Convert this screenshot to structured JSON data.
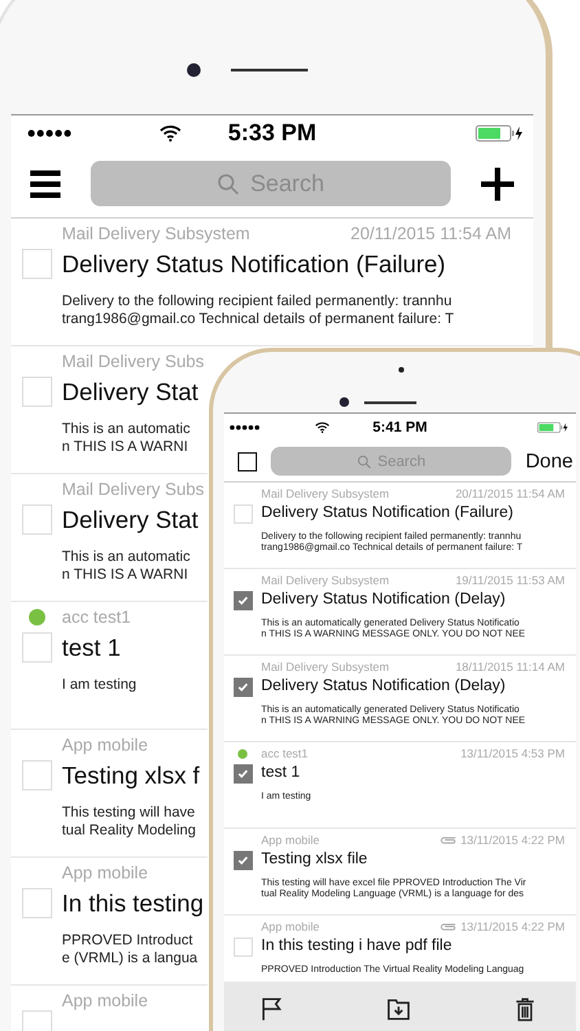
{
  "back_phone": {
    "status_bar": {
      "time": "5:33 PM"
    },
    "search": {
      "placeholder": "Search"
    },
    "messages": [
      {
        "sender": "Mail Delivery Subsystem",
        "date": "20/11/2015 11:54 AM",
        "title": "Delivery Status Notification (Failure)",
        "preview": [
          "Delivery to the following recipient failed permanently: trannhu",
          "trang1986@gmail.co Technical details of permanent failure: T"
        ],
        "checked": false,
        "unread": false
      },
      {
        "sender": "Mail Delivery Subs",
        "title": "Delivery Stat",
        "preview": [
          "This is an automatic",
          "n THIS IS A WARNI"
        ],
        "checked": false,
        "unread": false
      },
      {
        "sender": "Mail Delivery Subs",
        "title": "Delivery Stat",
        "preview": [
          "This is an automatic",
          "n THIS IS A WARNI"
        ],
        "checked": false,
        "unread": false
      },
      {
        "sender": "acc test1",
        "title": "test 1",
        "preview": [
          "I am testing"
        ],
        "checked": false,
        "unread": true
      },
      {
        "sender": "App mobile",
        "title": "Testing xlsx f",
        "preview": [
          "This testing will have",
          "tual Reality Modeling"
        ],
        "checked": false,
        "unread": false
      },
      {
        "sender": "App mobile",
        "title": "In this testing",
        "preview": [
          "PPROVED Introduct",
          "e (VRML) is a langua"
        ],
        "checked": false,
        "unread": false
      },
      {
        "sender": "App mobile",
        "checked": false,
        "unread": false
      }
    ]
  },
  "front_phone": {
    "status_bar": {
      "time": "5:41 PM"
    },
    "select_all": {
      "checked": false
    },
    "search": {
      "placeholder": "Search"
    },
    "done_button": "Done",
    "messages": [
      {
        "sender": "Mail Delivery Subsystem",
        "date": "20/11/2015 11:54 AM",
        "title": "Delivery Status Notification (Failure)",
        "preview": [
          "Delivery to the following recipient failed permanently: trannhu",
          "trang1986@gmail.co Technical details of permanent failure: T"
        ],
        "checked": false,
        "unread": false,
        "attachment": false
      },
      {
        "sender": "Mail Delivery Subsystem",
        "date": "19/11/2015 11:53 AM",
        "title": "Delivery Status Notification (Delay)",
        "preview": [
          "This is an automatically generated Delivery Status Notificatio",
          "n THIS IS A WARNING MESSAGE ONLY. YOU DO NOT NEE"
        ],
        "checked": true,
        "unread": false,
        "attachment": false
      },
      {
        "sender": "Mail Delivery Subsystem",
        "date": "18/11/2015 11:14 AM",
        "title": "Delivery Status Notification (Delay)",
        "preview": [
          "This is an automatically generated Delivery Status Notificatio",
          "n THIS IS A WARNING MESSAGE ONLY. YOU DO NOT NEE"
        ],
        "checked": true,
        "unread": false,
        "attachment": false
      },
      {
        "sender": "acc test1",
        "date": "13/11/2015 4:53 PM",
        "title": "test 1",
        "preview": [
          "I am testing"
        ],
        "checked": true,
        "unread": true,
        "attachment": false
      },
      {
        "sender": "App mobile",
        "date": "13/11/2015 4:22 PM",
        "title": "Testing xlsx file",
        "preview": [
          "This testing will have excel file PPROVED Introduction The Vir",
          "tual Reality Modeling Language (VRML) is a language for des"
        ],
        "checked": true,
        "unread": false,
        "attachment": true
      },
      {
        "sender": "App mobile",
        "date": "13/11/2015 4:22 PM",
        "title": "In this testing i have pdf file",
        "preview": [
          "PPROVED Introduction The Virtual Reality Modeling Languag"
        ],
        "checked": false,
        "unread": false,
        "attachment": true
      }
    ]
  }
}
